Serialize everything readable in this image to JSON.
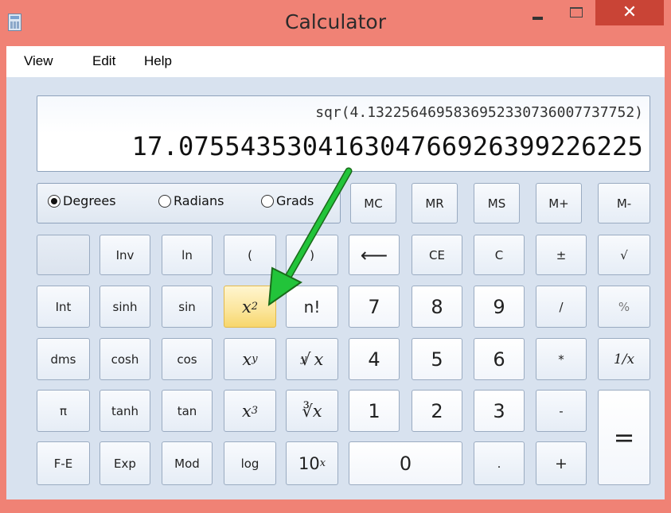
{
  "window": {
    "title": "Calculator",
    "close_glyph": "✕"
  },
  "menu": [
    "View",
    "Edit",
    "Help"
  ],
  "display": {
    "expression": "sqr(4.1322564695836952330736007737752)",
    "value": "17.075543530416304766926399226225"
  },
  "angle_mode": {
    "options": [
      "Degrees",
      "Radians",
      "Grads"
    ],
    "selected": "Degrees"
  },
  "memory": [
    "MC",
    "MR",
    "MS",
    "M+",
    "M-"
  ],
  "buttons": {
    "inv": "Inv",
    "ln": "ln",
    "open_paren": "(",
    "close_paren": ")",
    "backspace": "⟵",
    "ce": "CE",
    "c": "C",
    "plus_minus": "±",
    "sqrt": "√",
    "int": "Int",
    "sinh": "sinh",
    "sin": "sin",
    "x_squared_base": "x",
    "x_squared_exp": "2",
    "factorial": "n!",
    "seven": "7",
    "eight": "8",
    "nine": "9",
    "divide": "/",
    "percent": "%",
    "dms": "dms",
    "cosh": "cosh",
    "cos": "cos",
    "x_pow_y_base": "x",
    "x_pow_y_exp": "y",
    "yroot": "∛ x",
    "yroot_index": "y",
    "four": "4",
    "five": "5",
    "six": "6",
    "multiply": "*",
    "reciprocal": "1/x",
    "pi": "π",
    "tanh": "tanh",
    "tan": "tan",
    "x_cubed_base": "x",
    "x_cubed_exp": "3",
    "cube_root": "∛x",
    "one": "1",
    "two": "2",
    "three": "3",
    "minus": "-",
    "equals": "=",
    "fe": "F-E",
    "exp": "Exp",
    "mod": "Mod",
    "log": "log",
    "ten_pow_base": "10",
    "ten_pow_exp": "x",
    "zero": "0",
    "decimal": ".",
    "plus": "+"
  },
  "colors": {
    "titlebar": "#f08275",
    "highlight": "#fbe59a",
    "arrow": "#22c43a"
  }
}
